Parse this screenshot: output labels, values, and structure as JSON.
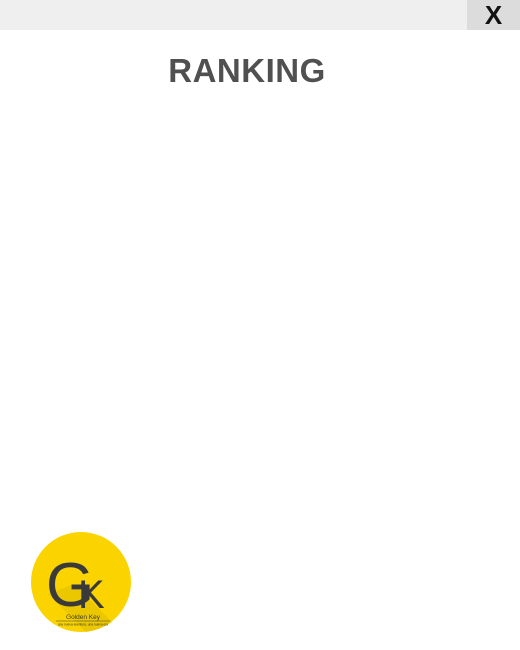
{
  "window": {
    "close_label": "X"
  },
  "main": {
    "title": "RANKING"
  },
  "logo": {
    "monogram_g": "G",
    "monogram_k": "K",
    "brand_name": "Golden Key",
    "tagline": "una nueva aventura, una nueva era",
    "colors": {
      "circle": "#fbd400",
      "shadow": "#c9a800",
      "letters": "#3a3a3a"
    }
  }
}
